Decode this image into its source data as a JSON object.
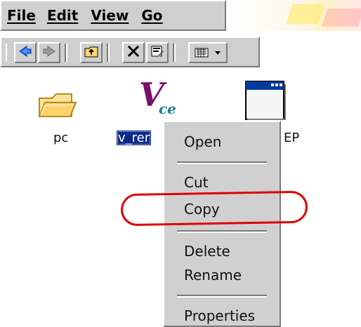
{
  "menubar": {
    "items": [
      {
        "label": "File"
      },
      {
        "label": "Edit"
      },
      {
        "label": "View"
      },
      {
        "label": "Go"
      }
    ]
  },
  "toolbar": {
    "buttons": [
      {
        "icon": "back-arrow-icon"
      },
      {
        "icon": "forward-arrow-icon"
      },
      {
        "icon": "folder-up-icon"
      },
      {
        "icon": "delete-x-icon"
      },
      {
        "icon": "properties-icon"
      },
      {
        "icon": "view-options-icon"
      }
    ]
  },
  "desktop": {
    "items": [
      {
        "icon": "folder-icon",
        "label": "pc"
      },
      {
        "icon": "vce-app-icon",
        "label": "v_rer",
        "selected": true
      },
      {
        "icon": "window-app-icon",
        "label": "EP"
      }
    ]
  },
  "context_menu": {
    "items": [
      {
        "label": "Open"
      },
      {
        "label": "Cut"
      },
      {
        "label": "Copy"
      },
      {
        "label": "Delete"
      },
      {
        "label": "Rename"
      },
      {
        "label": "Properties"
      }
    ]
  },
  "colors": {
    "selection_bg": "#0b2a88",
    "highlight_oval": "#e00000"
  }
}
